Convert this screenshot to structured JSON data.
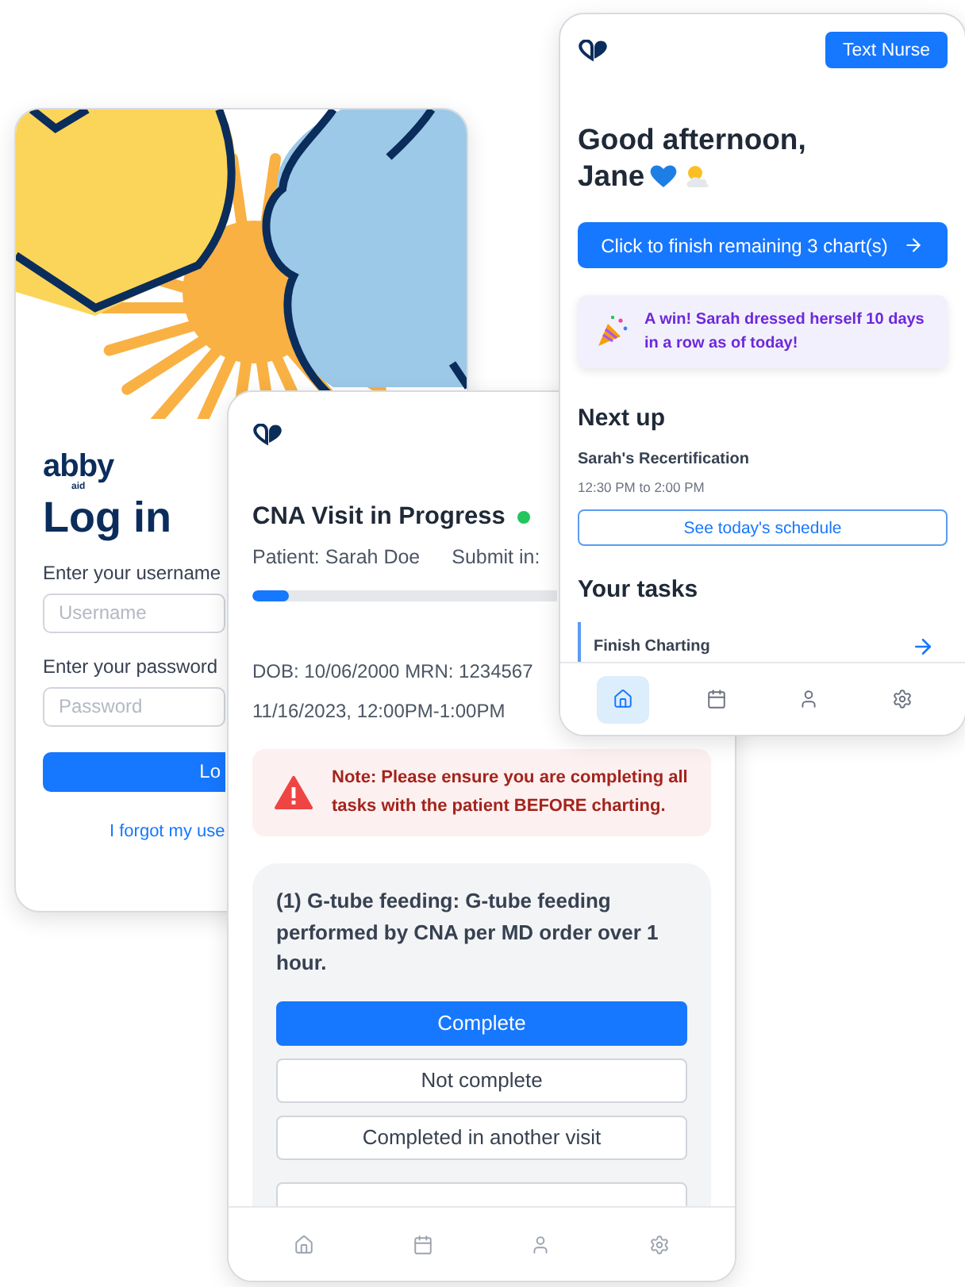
{
  "login_screen": {
    "logo": {
      "name": "abby",
      "sub": "aid"
    },
    "title": "Log in",
    "fields": [
      {
        "label": "Enter your username",
        "placeholder": "Username"
      },
      {
        "label": "Enter your password",
        "placeholder": "Password"
      }
    ],
    "login_button": "Lo",
    "forgot_link": "I forgot my use"
  },
  "visit_screen": {
    "title": "CNA Visit in Progress",
    "live": true,
    "patient": "Patient: Sarah Doe",
    "submit": "Submit in:",
    "progress": {
      "level": 0.12
    },
    "details": [
      "DOB: 10/06/2000  MRN: 1234567",
      "11/16/2023, 12:00PM-1:00PM"
    ],
    "note": "Note: Please ensure you are completing all tasks with the patient BEFORE charting.",
    "task": {
      "text": "(1) G-tube feeding: G-tube feeding performed by CNA per MD order over 1 hour.",
      "options": [
        {
          "label": "Complete",
          "selected": true
        },
        {
          "label": "Not complete",
          "selected": false
        },
        {
          "label": "Completed in another visit",
          "selected": false
        }
      ]
    },
    "nav": [
      {
        "kind": "home",
        "selected": false
      },
      {
        "kind": "calendar",
        "selected": false
      },
      {
        "kind": "profile",
        "selected": false
      },
      {
        "kind": "settings",
        "selected": false
      }
    ]
  },
  "home_screen": {
    "header_button": "Text Nurse",
    "greeting": [
      "Good afternoon,",
      "Jane"
    ],
    "cta": "Click to finish remaining 3 chart(s)",
    "win": "A win! Sarah dressed herself 10 days in a row as of today!",
    "next_up": {
      "heading": "Next up",
      "title": "Sarah's Recertification",
      "time": "12:30 PM to 2:00 PM",
      "button": "See today's schedule"
    },
    "tasks": {
      "heading": "Your tasks",
      "items": [
        {
          "title": "Finish Charting"
        }
      ]
    },
    "nav": [
      {
        "kind": "home",
        "selected": true
      },
      {
        "kind": "calendar",
        "selected": false
      },
      {
        "kind": "profile",
        "selected": false
      },
      {
        "kind": "settings",
        "selected": false
      }
    ]
  }
}
